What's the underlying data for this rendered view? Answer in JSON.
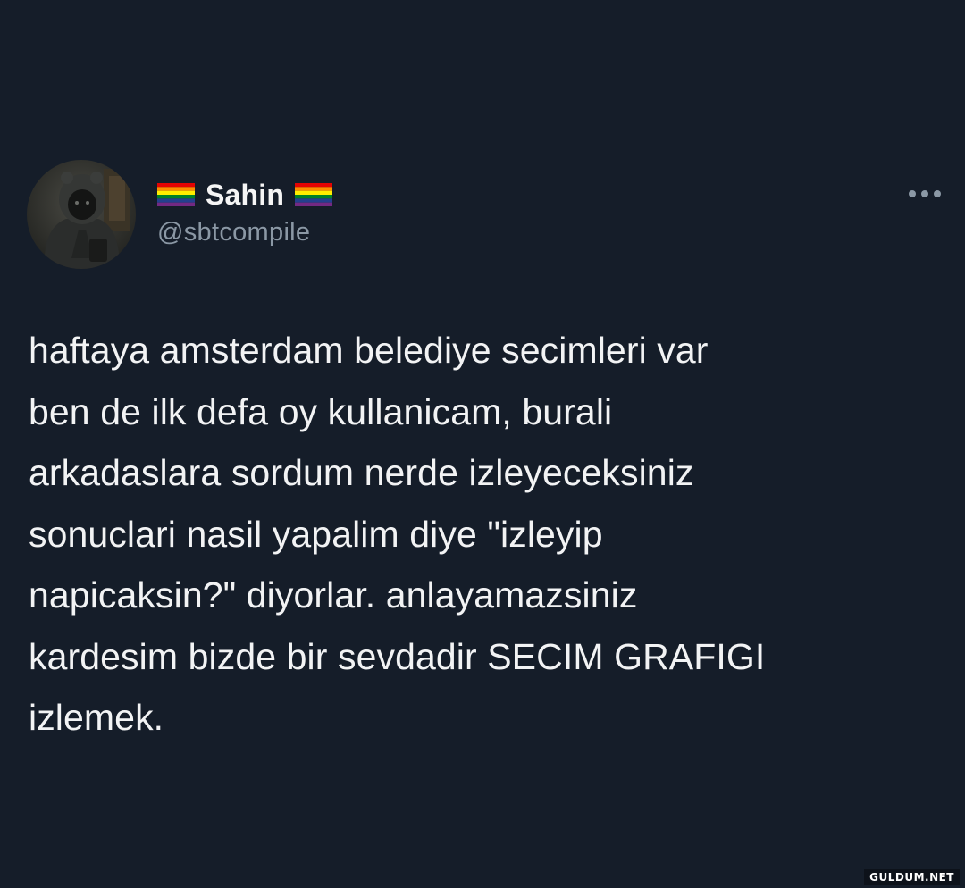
{
  "author": {
    "display_name": "Sahin",
    "handle": "@sbtcompile",
    "flag_icon": "rainbow-flag-icon",
    "avatar_icon": "hooded-figure-avatar"
  },
  "menu": {
    "more_icon": "more-options-icon",
    "more_label": "..."
  },
  "tweet": {
    "lines": [
      "haftaya amsterdam belediye secimleri var",
      "ben de ilk defa oy kullanicam, burali",
      "arkadaslara sordum nerde izleyeceksiniz",
      "sonuclari nasil yapalim diye \"izleyip",
      "napicaksin?\" diyorlar. anlayamazsiniz",
      "kardesim bizde bir sevdadir SECIM GRAFIGI",
      "izlemek."
    ]
  },
  "watermark": {
    "text": "GULDUM.NET"
  },
  "colors": {
    "background": "#151d29",
    "text": "#f2f3f4",
    "secondary_text": "#8b98a5",
    "flag_stripes": [
      "#e40303",
      "#ff8c00",
      "#ffed00",
      "#008026",
      "#24408e",
      "#732982"
    ]
  }
}
